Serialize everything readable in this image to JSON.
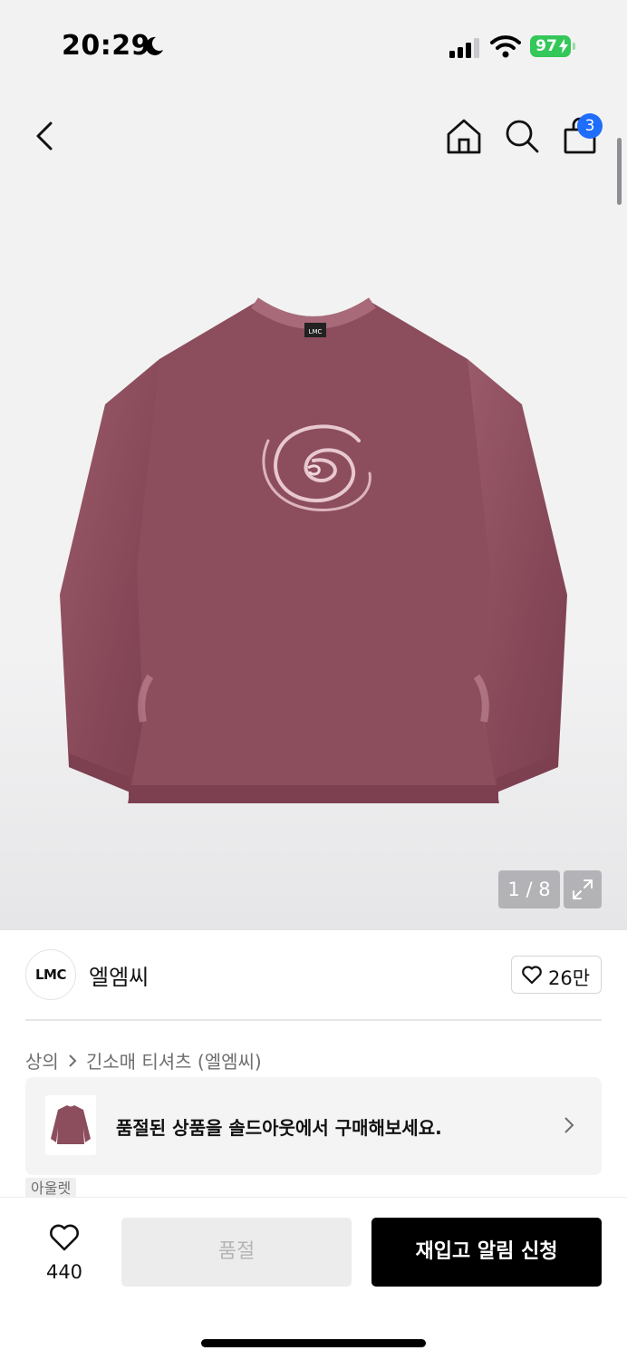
{
  "status_bar": {
    "time": "20:29",
    "battery_percent": "97"
  },
  "nav": {
    "cart_count": "3"
  },
  "gallery": {
    "counter": "1 / 8",
    "product_logo": "LMC"
  },
  "brand": {
    "logo_text": "LMC",
    "name": "엘엠씨",
    "likes": "26만"
  },
  "breadcrumb": {
    "category": "상의",
    "subcategory": "긴소매 티셔츠 (엘엠씨)"
  },
  "soldout_banner": {
    "text": "품절된 상품을 솔드아웃에서 구매해보세요."
  },
  "tag": {
    "label": "아울렛"
  },
  "bottom_bar": {
    "wish_count": "440",
    "soldout_label": "품절",
    "restock_label": "재입고 알림 신청"
  },
  "colors": {
    "accent_blue": "#1e6dfb",
    "battery_green": "#34c759",
    "shirt": "#8a4a5a",
    "black": "#000000"
  }
}
